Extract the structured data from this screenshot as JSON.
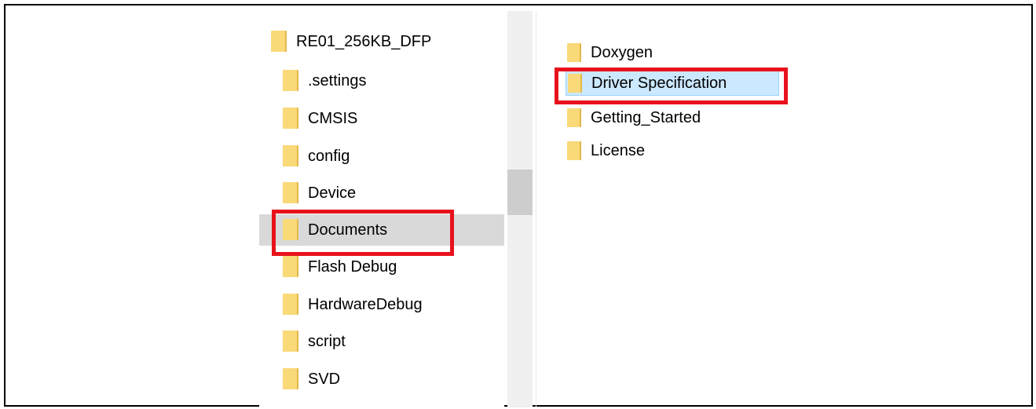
{
  "tree": {
    "root": {
      "label": "RE01_256KB_DFP",
      "icon": "folder-icon"
    },
    "items": [
      {
        "label": ".settings",
        "icon": "folder-icon",
        "selected": false
      },
      {
        "label": "CMSIS",
        "icon": "folder-icon",
        "selected": false
      },
      {
        "label": "config",
        "icon": "folder-icon",
        "selected": false
      },
      {
        "label": "Device",
        "icon": "folder-icon",
        "selected": false
      },
      {
        "label": "Documents",
        "icon": "folder-icon",
        "selected": true
      },
      {
        "label": "Flash Debug",
        "icon": "folder-icon",
        "selected": false
      },
      {
        "label": "HardwareDebug",
        "icon": "folder-icon",
        "selected": false
      },
      {
        "label": "script",
        "icon": "folder-icon",
        "selected": false
      },
      {
        "label": "SVD",
        "icon": "folder-icon",
        "selected": false
      }
    ]
  },
  "file_list": {
    "items": [
      {
        "label": "Doxygen",
        "icon": "folder-icon",
        "selected": false
      },
      {
        "label": "Driver Specification",
        "icon": "folder-icon",
        "selected": true
      },
      {
        "label": "Getting_Started",
        "icon": "folder-icon",
        "selected": false
      },
      {
        "label": "License",
        "icon": "folder-icon",
        "selected": false
      }
    ]
  },
  "colors": {
    "highlight_border": "#e8121c",
    "tree_selected_bg": "#d9d9d9",
    "list_selected_bg": "#cce8ff",
    "folder_fill": "#f9d978"
  }
}
